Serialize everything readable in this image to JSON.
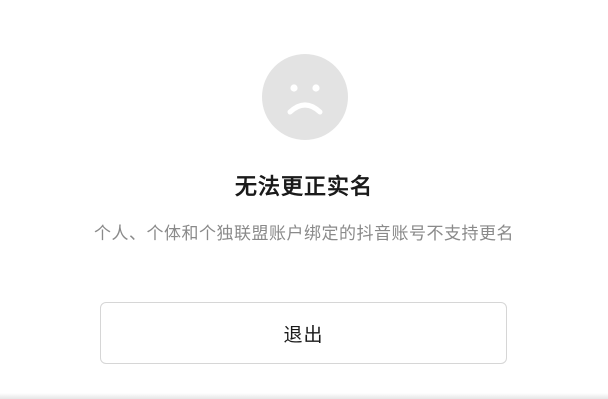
{
  "dialog": {
    "icon": "sad-face-icon",
    "title": "无法更正实名",
    "message": "个人、个体和个独联盟账户绑定的抖音账号不支持更名",
    "exit_label": "退出"
  },
  "colors": {
    "icon_background": "#e3e3e3",
    "icon_face": "#ffffff",
    "title_text": "#1a1a1a",
    "message_text": "#8a8a8a",
    "button_border": "#d6d6d6"
  }
}
